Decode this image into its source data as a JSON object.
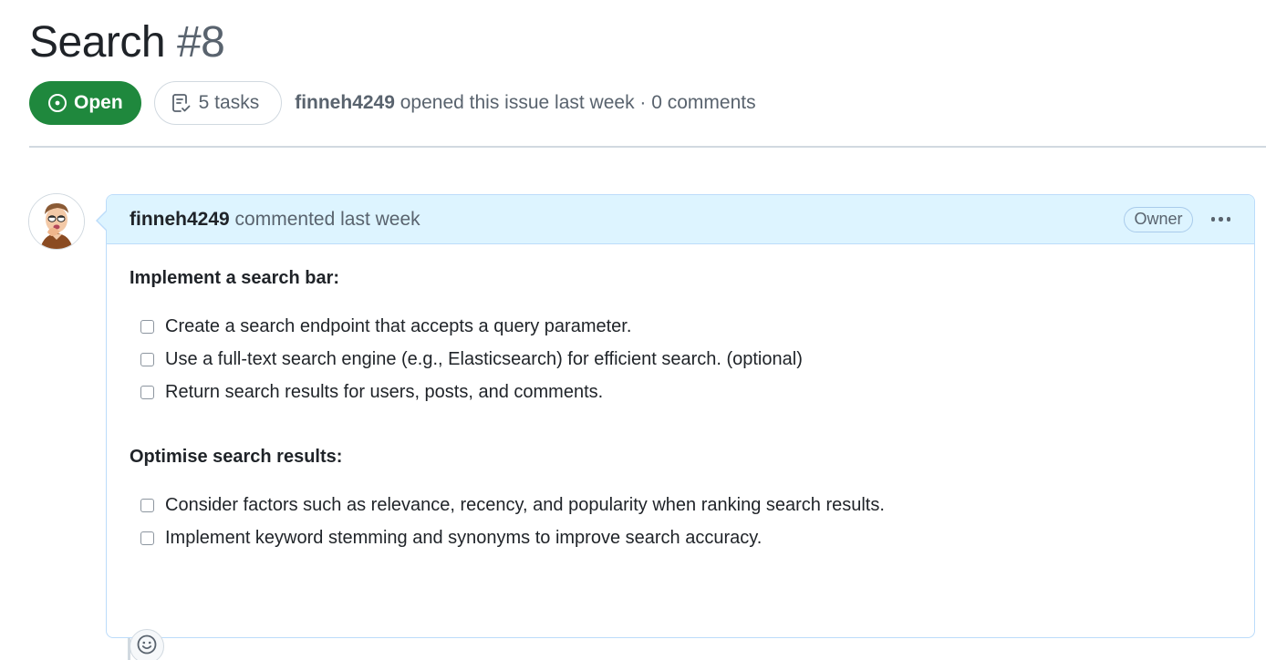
{
  "issue": {
    "title": "Search",
    "number": "#8",
    "state_label": "Open",
    "tasks_label": "5 tasks",
    "author": "finneh4249",
    "meta_text": " opened this issue last week · 0 comments"
  },
  "comment": {
    "author": "finneh4249",
    "timestamp_text": " commented last week",
    "role_badge": "Owner",
    "sections": [
      {
        "heading": "Implement a search bar:",
        "tasks": [
          "Create a search endpoint that accepts a query parameter.",
          "Use a full-text search engine (e.g., Elasticsearch) for efficient search. (optional)",
          "Return search results for users, posts, and comments."
        ]
      },
      {
        "heading": "Optimise search results:",
        "tasks": [
          "Consider factors such as relevance, recency, and popularity when ranking search results.",
          "Implement keyword stemming and synonyms to improve search accuracy."
        ]
      }
    ]
  },
  "icons": {
    "state": "issue-opened-icon",
    "tasks": "checklist-icon",
    "more": "kebab-horizontal-icon",
    "reaction": "smiley-icon"
  },
  "colors": {
    "open_green": "#1f883d",
    "comment_header_bg": "#ddf4ff",
    "comment_border": "#bcdcfa",
    "muted_text": "#59636e"
  }
}
